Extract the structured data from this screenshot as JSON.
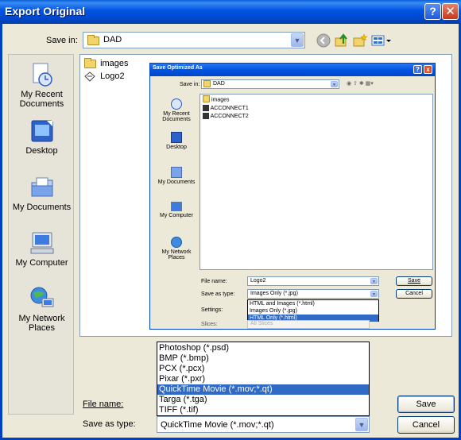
{
  "window": {
    "title": "Export Original",
    "help": "?",
    "close": "✕"
  },
  "toolbar": {
    "save_in_label": "Save in:",
    "save_in_value": "DAD"
  },
  "places": [
    {
      "label": "My Recent Documents"
    },
    {
      "label": "Desktop"
    },
    {
      "label": "My Documents"
    },
    {
      "label": "My Computer"
    },
    {
      "label": "My Network Places"
    }
  ],
  "files": [
    "images",
    "Logo2"
  ],
  "file_name": {
    "label": "File name:",
    "value": ""
  },
  "save_as_type": {
    "label": "Save as type:",
    "value": "QuickTime Movie (*.mov;*.qt)",
    "options": [
      "Photoshop (*.psd)",
      "BMP (*.bmp)",
      "PCX (*.pcx)",
      "Pixar (*.pxr)",
      "QuickTime Movie (*.mov;*.qt)",
      "Targa (*.tga)",
      "TIFF (*.tif)"
    ],
    "selected_index": 4
  },
  "buttons": {
    "save": "Save",
    "cancel": "Cancel"
  },
  "inner_dialog": {
    "title": "Save Optimized As",
    "save_in_label": "Save in:",
    "save_in_value": "DAD",
    "places": [
      "My Recent Documents",
      "Desktop",
      "My Documents",
      "My Computer",
      "My Network Places"
    ],
    "files": [
      "images",
      "ACCONNECT1",
      "ACCONNECT2"
    ],
    "file_name_label": "File name:",
    "file_name_value": "Logo2",
    "save_as_type_label": "Save as type:",
    "save_as_type_value": "Images Only (*.jpg)",
    "settings_label": "Settings:",
    "slices_label": "Slices:",
    "slices_value": "All Slices",
    "type_options": [
      "HTML and Images (*.html)",
      "Images Only (*.jpg)",
      "HTML Only (*.html)"
    ],
    "save": "Save",
    "cancel": "Cancel"
  }
}
